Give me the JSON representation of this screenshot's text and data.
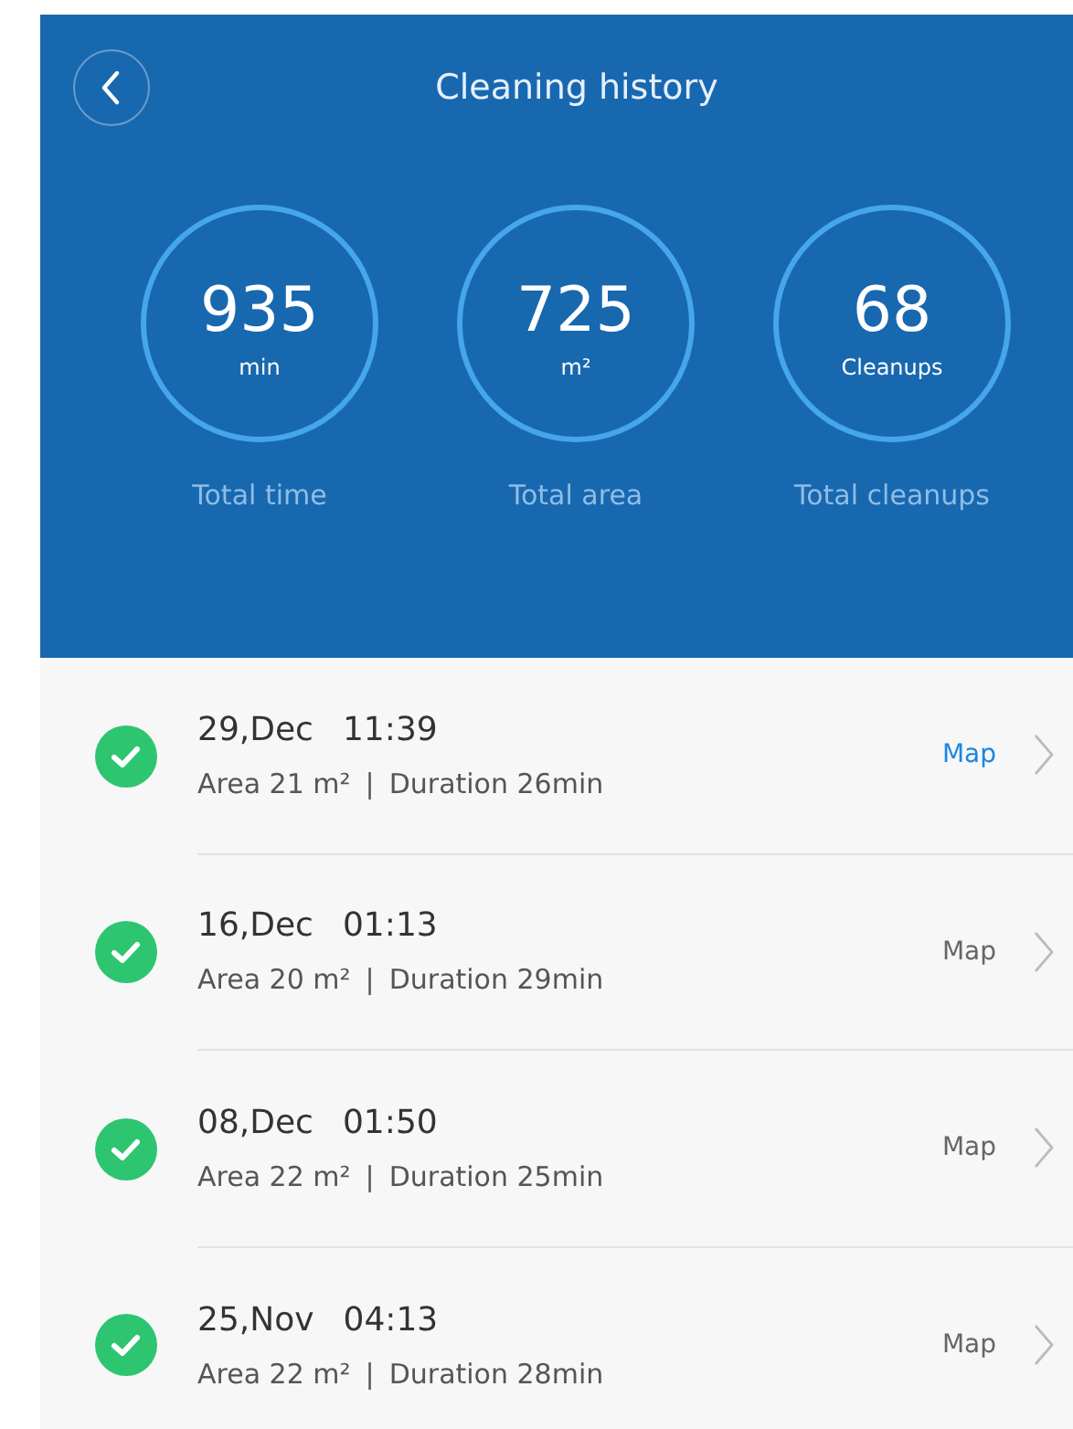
{
  "header": {
    "title": "Cleaning history"
  },
  "stats": [
    {
      "value": "935",
      "unit": "min",
      "label": "Total time"
    },
    {
      "value": "725",
      "unit": "m²",
      "label": "Total area"
    },
    {
      "value": "68",
      "unit": "Cleanups",
      "label": "Total cleanups"
    }
  ],
  "records": [
    {
      "date": "29,Dec",
      "time": "11:39",
      "area": "Area 21 m²",
      "separator": "|",
      "duration": "Duration 26min",
      "map": "Map",
      "selected": true
    },
    {
      "date": "16,Dec",
      "time": "01:13",
      "area": "Area 20 m²",
      "separator": "|",
      "duration": "Duration 29min",
      "map": "Map",
      "selected": false
    },
    {
      "date": "08,Dec",
      "time": "01:50",
      "area": "Area 22 m²",
      "separator": "|",
      "duration": "Duration 25min",
      "map": "Map",
      "selected": false
    },
    {
      "date": "25,Nov",
      "time": "04:13",
      "area": "Area 22 m²",
      "separator": "|",
      "duration": "Duration 28min",
      "map": "Map",
      "selected": false
    }
  ]
}
